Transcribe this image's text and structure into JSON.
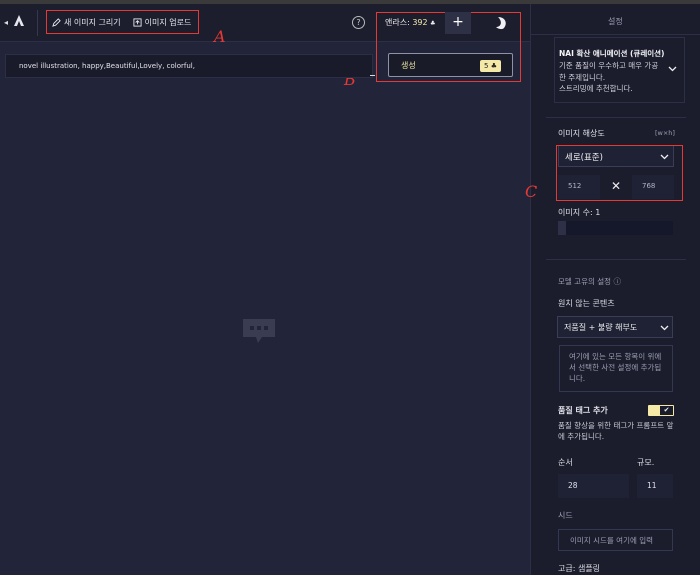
{
  "topbar": {
    "tabs": [
      {
        "label": "새 이미지 그리기",
        "icon": "pencil-icon"
      },
      {
        "label": "이미지 업로드",
        "icon": "upload-icon"
      }
    ],
    "help_label": "?",
    "anlas_label": "앤라스:",
    "anlas_value": "392",
    "plus_label": "+",
    "generate_label": "생성",
    "generate_cost": "5"
  },
  "prompt": {
    "value": "novel illustration, happy,Beautiful,Lovely, colorful,"
  },
  "annotations": {
    "a": "A",
    "b": "B",
    "c": "C"
  },
  "sidebar": {
    "title": "설정",
    "model": {
      "name": "NAI 확산 애니메이션 (큐레이션)",
      "desc_lines": [
        "기준 품질이 우수하고 매우 가공",
        "한 주제입니다.",
        "스트리밍에 추천합니다."
      ]
    },
    "resolution": {
      "label": "이미지 해상도",
      "unit": "[w×h]",
      "selected": "세로(표준)",
      "width": "512",
      "times": "✕",
      "height": "768"
    },
    "image_count_label": "이미지 수: 1",
    "image_count": {
      "value": 1,
      "max": 8
    },
    "model_settings_label": "모델 고유의 설정 ⓘ",
    "undesired": {
      "label": "원치 않는 콘텐츠",
      "selected": "저품질 + 불량 해부도",
      "box_text": "여기에 있는 모든 항목이 위에서 선택한 사전 설정에 추가됩니다."
    },
    "quality": {
      "label": "품질 태그 추가",
      "enabled": true,
      "check": "✔",
      "desc": "품질 향상을 위한 태그가 프롬프트 앞에 추가됩니다."
    },
    "steps": {
      "label": "순서",
      "value": "28"
    },
    "scale": {
      "label": "규모.",
      "value": "11"
    },
    "seed": {
      "label": "시드",
      "placeholder": "이미지 시드를 여기에 입력"
    },
    "advanced_label": "고급: 샘플링"
  },
  "colors": {
    "accent": "#f5e9a8",
    "annotation": "#e53935",
    "background": "#22243a",
    "sidebar": "#1b1d2c"
  }
}
